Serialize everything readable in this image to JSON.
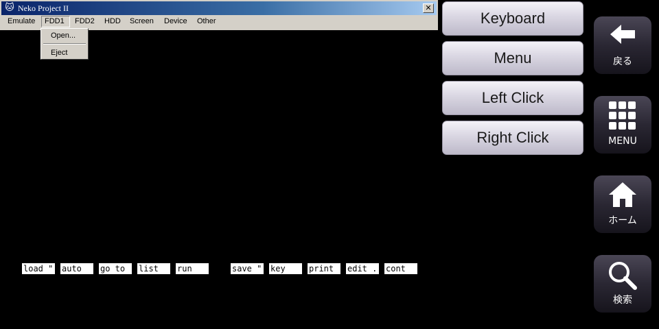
{
  "window": {
    "title": "Neko Project II",
    "close_glyph": "✕",
    "menu": [
      "Emulate",
      "FDD1",
      "FDD2",
      "HDD",
      "Screen",
      "Device",
      "Other"
    ],
    "active_menu": "FDD1",
    "dropdown": [
      "Open...",
      "Eject"
    ]
  },
  "function_keys": [
    "load \"",
    "auto",
    "go to",
    "list",
    "run",
    "save \"",
    "key",
    "print",
    "edit .",
    "cont"
  ],
  "controls": [
    "Keyboard",
    "Menu",
    "Left Click",
    "Right Click"
  ],
  "nav": [
    {
      "label": "戻る",
      "icon": "back-arrow-icon"
    },
    {
      "label": "MENU",
      "icon": "grid-menu-icon"
    },
    {
      "label": "ホーム",
      "icon": "home-icon"
    },
    {
      "label": "検索",
      "icon": "search-icon"
    }
  ],
  "colors": {
    "background": "#000000",
    "titlebar": "#0a246a",
    "window_face": "#d4d0c8",
    "function_key_bg": "#ffffff"
  }
}
